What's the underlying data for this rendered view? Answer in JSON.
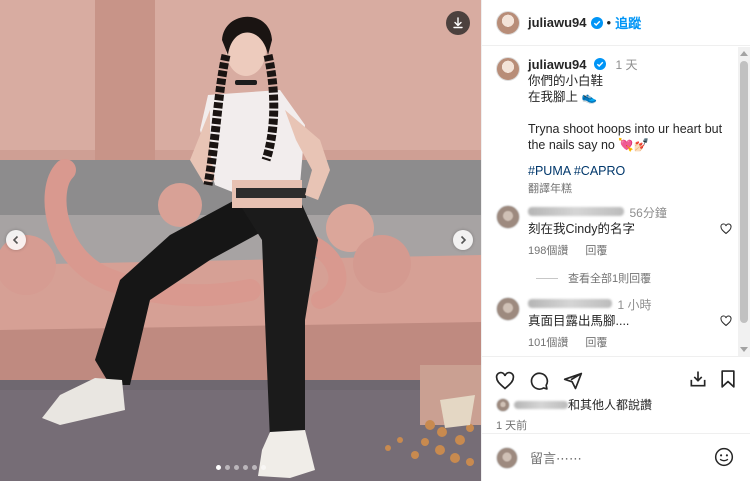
{
  "post": {
    "username": "juliawu94",
    "follow_label": "追蹤",
    "separator": "•",
    "caption_lines": [
      "你們的小白鞋",
      "在我腳上 👟",
      "",
      "Tryna shoot hoops into ur heart but the nails say no 💘💅🏻"
    ],
    "hashtags": "#PUMA #CAPRO",
    "caption_time": "1 天",
    "translate_label": "翻譯年糕"
  },
  "comments": [
    {
      "time": "56分鐘",
      "text": "刻在我Cindy的名字",
      "likes": "198個讚",
      "reply": "回覆"
    },
    {
      "time": "1 小時",
      "text": "真面目露出馬腳....",
      "likes": "101個讚",
      "reply": "回覆"
    }
  ],
  "view_replies": "查看全部1則回覆",
  "likes_text": "和其他人都說讚",
  "posted_ago": "1 天前",
  "comment_placeholder": "留言⋯⋯",
  "carousel": {
    "count": 6,
    "active": 0
  },
  "icons": {
    "download": "download-icon",
    "prev": "chevron-left-icon",
    "next": "chevron-right-icon",
    "verified": "verified-badge-icon",
    "like": "heart-icon",
    "comment": "comment-icon",
    "share": "send-icon",
    "save": "bookmark-icon",
    "repost": "share-box-icon",
    "emoji": "emoji-icon"
  },
  "colors": {
    "accent": "#0095f6",
    "verified": "#0095f6",
    "wall": "#cf9f94"
  }
}
